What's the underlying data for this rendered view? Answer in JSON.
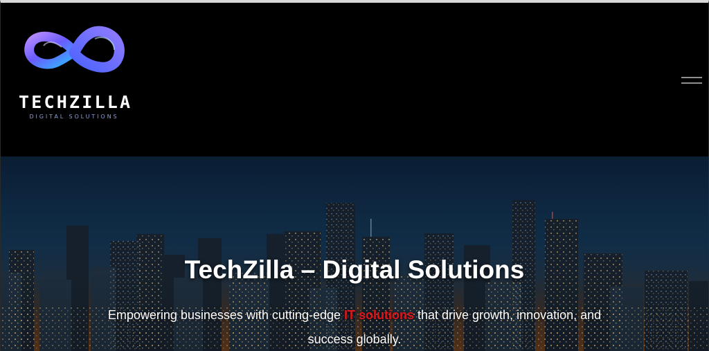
{
  "colors": {
    "header_background": "#000000",
    "accent": "#e0141b",
    "logo_gradient_start": "#6a5cff",
    "logo_gradient_end": "#2fb8ff",
    "tagline": "#8aa2d8"
  },
  "header": {
    "logo": {
      "icon": "infinity-logo-icon",
      "name": "TECHZILLA",
      "tagline": "DIGITAL SOLUTIONS"
    },
    "menu_toggle": {
      "icon": "hamburger-menu-icon"
    }
  },
  "hero": {
    "background": "city-skyline-at-night",
    "title": "TechZilla – Digital Solutions",
    "text_before": "Empowering businesses with cutting-edge ",
    "text_highlight": "IT solutions",
    "text_after": " that drive growth, innovation, and success globally."
  }
}
